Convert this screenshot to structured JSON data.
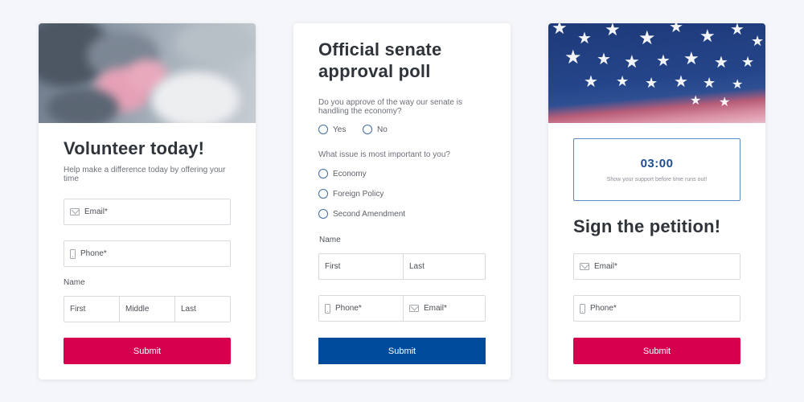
{
  "colors": {
    "accent_red": "#d6004f",
    "accent_blue": "#004b9b",
    "timer_blue": "#1f4f8f"
  },
  "volunteer": {
    "title": "Volunteer today!",
    "subtitle": "Help make a difference today by offering your time",
    "email_placeholder": "Email*",
    "phone_placeholder": "Phone*",
    "name_label": "Name",
    "first": "First",
    "middle": "Middle",
    "last": "Last",
    "submit": "Submit"
  },
  "poll": {
    "title": "Official senate approval poll",
    "q1": "Do you approve of the way our senate is handling the economy?",
    "q1_options": [
      "Yes",
      "No"
    ],
    "q2": "What issue is most important to you?",
    "q2_options": [
      "Economy",
      "Foreign Policy",
      "Second Amendment"
    ],
    "name_label": "Name",
    "first": "First",
    "last": "Last",
    "phone_placeholder": "Phone*",
    "email_placeholder": "Email*",
    "submit": "Submit"
  },
  "petition": {
    "timer": "03:00",
    "timer_note": "Show your support before time runs out!",
    "title": "Sign the petition!",
    "email_placeholder": "Email*",
    "phone_placeholder": "Phone*",
    "submit": "Submit"
  }
}
